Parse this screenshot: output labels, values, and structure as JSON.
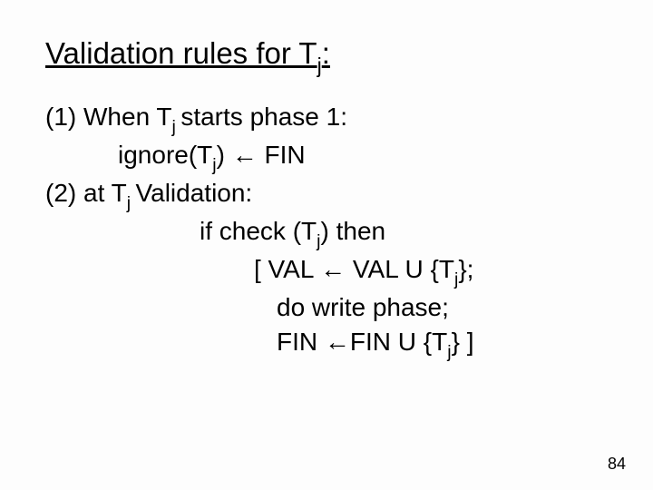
{
  "title_pre": "Validation rules for T",
  "title_sub": "j",
  "title_post": ":",
  "line1_a": "(1) When T",
  "line1_sub": "j ",
  "line1_b": "starts phase 1:",
  "line2_a": "ignore(T",
  "line2_sub": "j",
  "line2_b": ") ← FIN",
  "line3_a": "(2) at T",
  "line3_sub": "j ",
  "line3_b": "Validation:",
  "line4_a": "if check (T",
  "line4_sub": "j",
  "line4_b": ") then",
  "line5_a": "[ VAL ← VAL U {T",
  "line5_sub": "j",
  "line5_b": "};",
  "line6": "do write phase;",
  "line7_a": "FIN  ←FIN U {T",
  "line7_sub": "j",
  "line7_b": "}  ]",
  "page_number": "84"
}
